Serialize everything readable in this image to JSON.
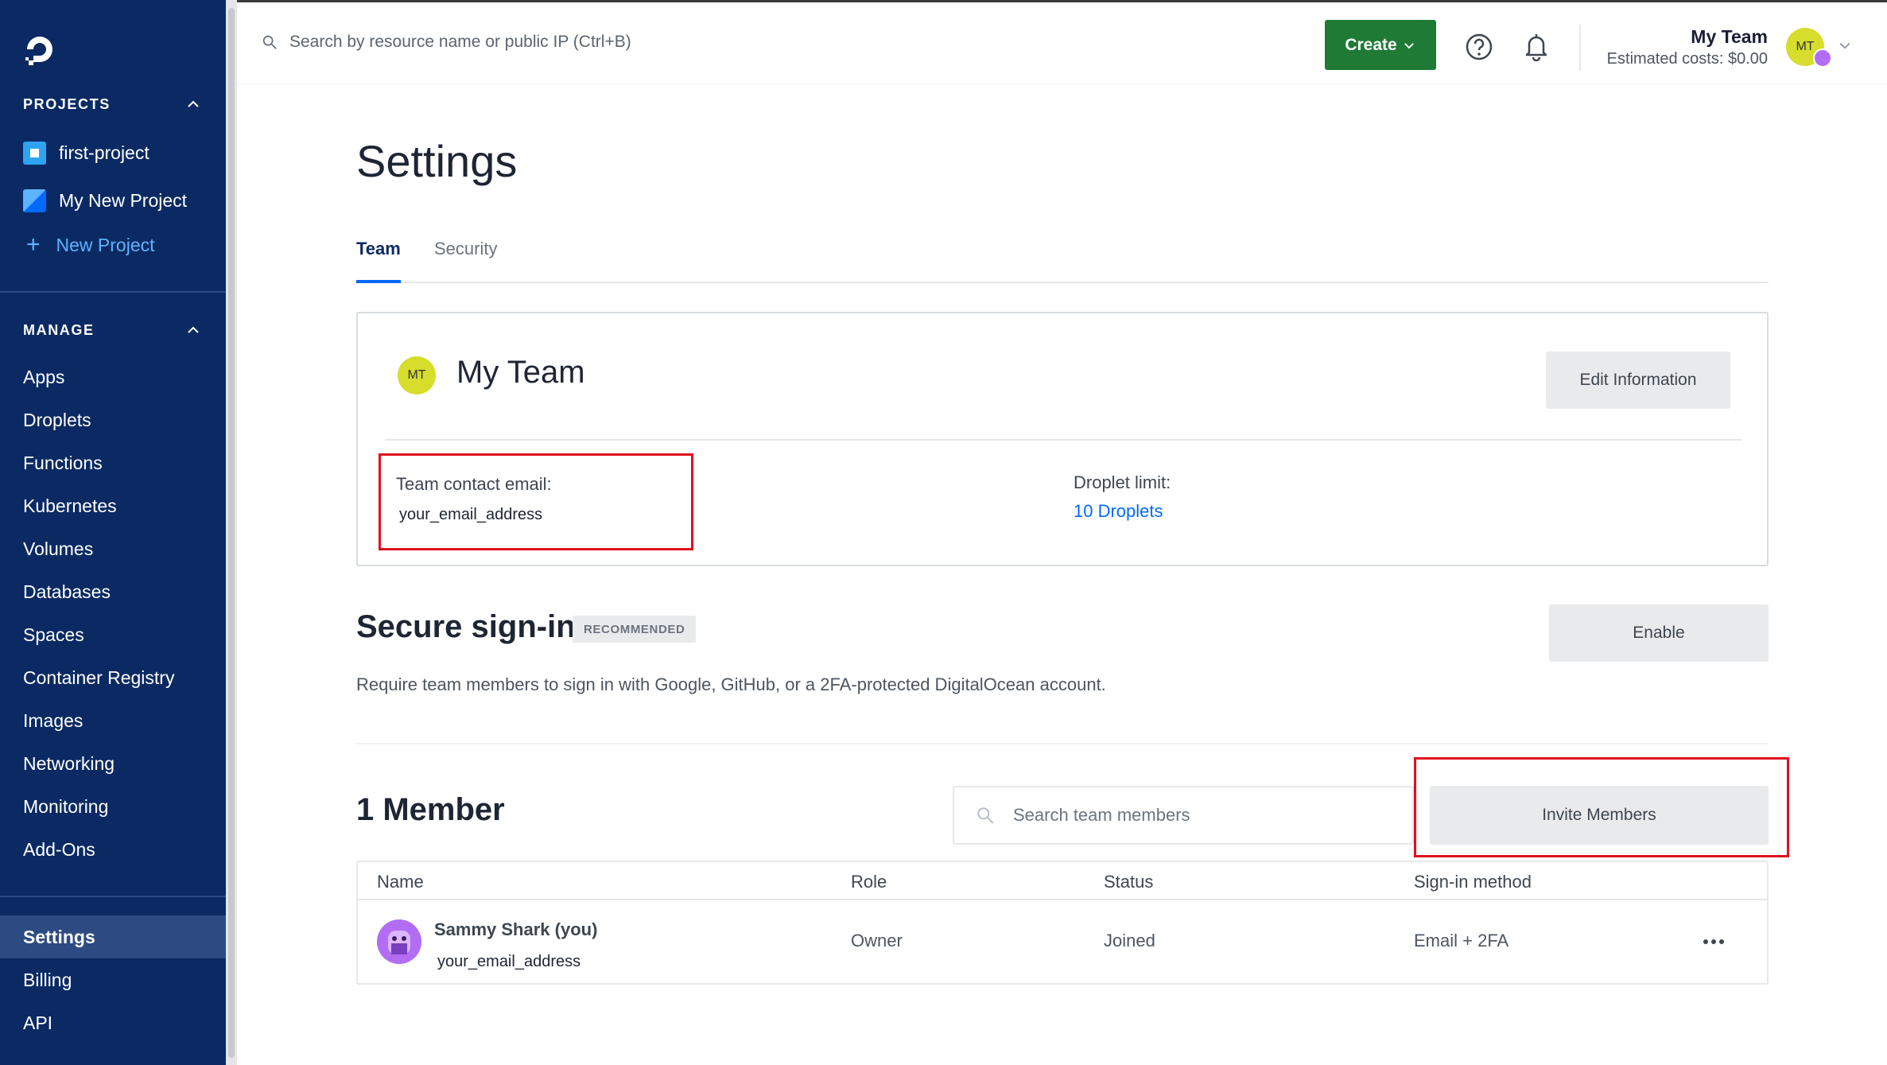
{
  "sidebar": {
    "projects_heading": "PROJECTS",
    "projects": [
      {
        "label": "first-project",
        "color": "#2ea3f2"
      },
      {
        "label": "My New Project",
        "color": "#0069ff"
      }
    ],
    "new_project": "New Project",
    "manage_heading": "MANAGE",
    "manage_items": [
      "Apps",
      "Droplets",
      "Functions",
      "Kubernetes",
      "Volumes",
      "Databases",
      "Spaces",
      "Container Registry",
      "Images",
      "Networking",
      "Monitoring",
      "Add-Ons"
    ],
    "bottom_items": [
      "Settings",
      "Billing",
      "API"
    ],
    "active_item": "Settings"
  },
  "topbar": {
    "search_placeholder": "Search by resource name or public IP (Ctrl+B)",
    "create_label": "Create",
    "team_name": "My Team",
    "estimated_costs": "Estimated costs: $0.00",
    "avatar_initials": "MT"
  },
  "page": {
    "title": "Settings",
    "tabs": [
      "Team",
      "Security"
    ],
    "active_tab": "Team"
  },
  "team_card": {
    "avatar_initials": "MT",
    "team_name": "My Team",
    "edit_label": "Edit Information",
    "contact_email_label": "Team contact email:",
    "contact_email_value": "your_email_address",
    "droplet_limit_label": "Droplet limit:",
    "droplet_limit_value": "10 Droplets"
  },
  "secure_signin": {
    "title": "Secure sign-in",
    "badge": "RECOMMENDED",
    "enable_label": "Enable",
    "description": "Require team members to sign in with Google, GitHub, or a 2FA-protected DigitalOcean account."
  },
  "members": {
    "title": "1 Member",
    "search_placeholder": "Search team members",
    "invite_label": "Invite Members",
    "columns": [
      "Name",
      "Role",
      "Status",
      "Sign-in method"
    ],
    "rows": [
      {
        "name": "Sammy Shark (you)",
        "email": "your_email_address",
        "role": "Owner",
        "status": "Joined",
        "signin": "Email + 2FA"
      }
    ]
  },
  "colors": {
    "sidebar_bg": "#0b2a63",
    "accent": "#0069ff",
    "create_green": "#1f7a36",
    "highlight_red": "#e0101f"
  }
}
